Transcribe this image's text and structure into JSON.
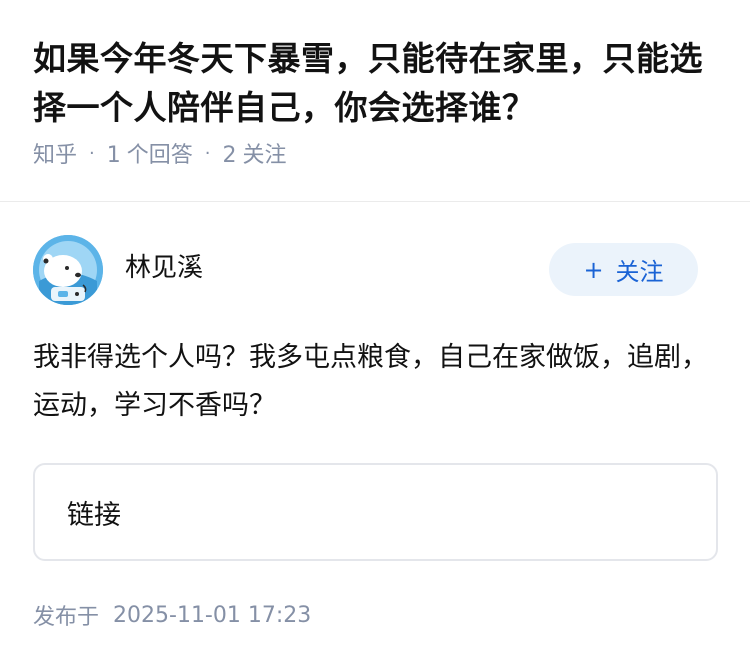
{
  "question": {
    "title": "如果今年冬天下暴雪，只能待在家里，只能选择一个人陪伴自己，你会选择谁？",
    "source": "知乎",
    "separator": "·",
    "answer_count": "1",
    "answer_label": "个回答",
    "follow_count": "2",
    "follow_label": "关注"
  },
  "author": {
    "name": "林见溪",
    "follow_button_plus": "+",
    "follow_button_label": "关注",
    "avatar_icon": "polar-bear-astronaut-avatar"
  },
  "answer": {
    "text": "我非得选个人吗？我多屯点粮食，自己在家做饭，追剧，运动，学习不香吗？",
    "link_label": "链接"
  },
  "footer": {
    "published_label": "发布于",
    "published_time": "2025-11-01 17:23"
  },
  "colors": {
    "text": "#121212",
    "meta": "#8590a6",
    "accent": "#1a63d5",
    "follow_bg": "#ebf3fb",
    "border": "#e4e6eb"
  }
}
